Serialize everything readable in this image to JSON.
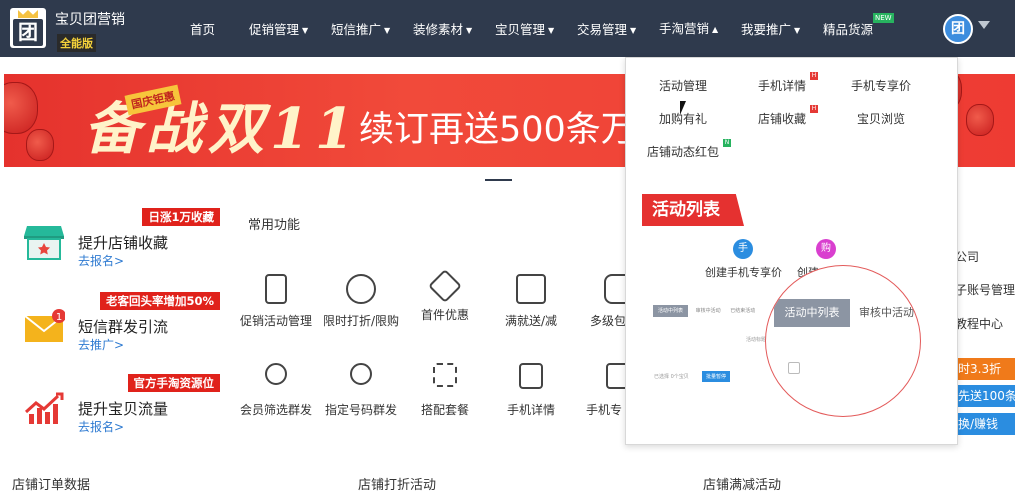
{
  "header": {
    "brand": "宝贝团营销",
    "edition": "全能版",
    "nav": [
      {
        "label": "首页",
        "caret": false
      },
      {
        "label": "促销管理",
        "caret": true
      },
      {
        "label": "短信推广",
        "caret": true
      },
      {
        "label": "装修素材",
        "caret": true
      },
      {
        "label": "宝贝管理",
        "caret": true
      },
      {
        "label": "交易管理",
        "caret": true
      },
      {
        "label": "手淘营销",
        "caret": true,
        "active": true
      },
      {
        "label": "我要推广",
        "caret": true
      },
      {
        "label": "精品货源",
        "caret": false,
        "badge": "NEW"
      }
    ],
    "avatar_text": "团"
  },
  "banner": {
    "tag": "国庆钜惠",
    "title": "备战双11",
    "subtitle": "续订再送500条万"
  },
  "promos": [
    {
      "ribbon": "日涨1万收藏",
      "title": "提升店铺收藏",
      "link": "去报名>"
    },
    {
      "ribbon": "老客回头率增加50%",
      "title": "短信群发引流",
      "link": "去推广>",
      "badge": "1"
    },
    {
      "ribbon": "官方手淘资源位",
      "title": "提升宝贝流量",
      "link": "去报名>"
    }
  ],
  "common": {
    "label": "常用功能",
    "row1": [
      "促销活动管理",
      "限时打折/限购",
      "首件优惠",
      "满就送/减",
      "多级包"
    ],
    "row2": [
      "会员筛选群发",
      "指定号码群发",
      "搭配套餐",
      "手机详情",
      "手机专"
    ]
  },
  "right_col": {
    "texts": [
      "公司",
      "子账号管理",
      "教程中心"
    ],
    "buttons": [
      {
        "label": "时3.3折",
        "color": "#f07a1a"
      },
      {
        "label": "先送100条",
        "color": "#2b8de0"
      },
      {
        "label": "换/赚钱",
        "color": "#2b8de0"
      }
    ]
  },
  "bottom": [
    "店铺订单数据",
    "店铺打折活动",
    "店铺满减活动"
  ],
  "dropdown": {
    "items": [
      {
        "label": "活动管理"
      },
      {
        "label": "手机详情",
        "hot": true
      },
      {
        "label": "手机专享价"
      },
      {
        "label": "加购有礼"
      },
      {
        "label": "店铺收藏",
        "hot": true
      },
      {
        "label": "宝贝浏览"
      },
      {
        "label": "店铺动态红包",
        "new": true
      }
    ],
    "hot_mark": "H",
    "new_mark": "N",
    "preview": {
      "ribbon": "活动列表",
      "icons": [
        {
          "glyph": "手",
          "label": "创建手机专享价",
          "color": "#2b8de0"
        },
        {
          "glyph": "购",
          "label": "创建",
          "color": "#d93fcf"
        }
      ],
      "thumb_tabs": [
        "活动中列表",
        "审核中活动",
        "已结束活动"
      ],
      "thumb_small": "活动标题",
      "thumb_row": [
        "已选择",
        "0个宝贝"
      ],
      "thumb_btn": "批量暂停",
      "zoom_tabs": [
        "活动中列表",
        "审核中活动"
      ]
    }
  }
}
